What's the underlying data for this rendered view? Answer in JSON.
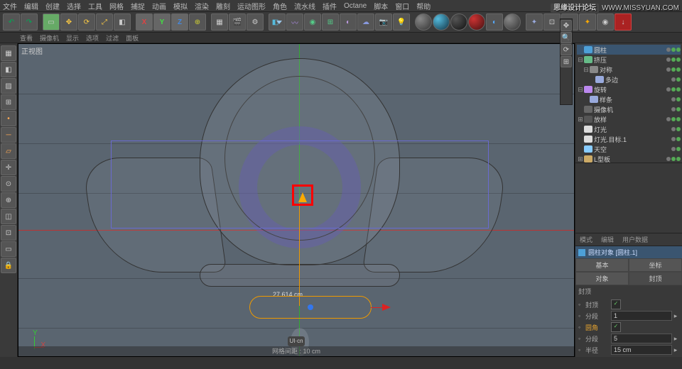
{
  "menu": {
    "file": "文件",
    "edit": "编辑",
    "create": "创建",
    "select": "选择",
    "tools": "工具",
    "mesh": "网格",
    "capture": "捕捉",
    "animate": "动画",
    "simulate": "模拟",
    "render": "渲染",
    "sculpt": "雕刻",
    "motiongfx": "运动图形",
    "character": "角色",
    "pipeline": "流水线",
    "plugins": "插件",
    "octane": "Octane",
    "script": "脚本",
    "window": "窗口",
    "help": "帮助"
  },
  "subbar": {
    "view": "查看",
    "camera": "摄像机",
    "display": "显示",
    "options": "选项",
    "filter": "过滤",
    "panel": "面板"
  },
  "viewport": {
    "title": "正视图",
    "dim": "27.614 cm",
    "gridinfo": "网格间距 : 10 cm",
    "logo": "UI·cn"
  },
  "watermark": {
    "label": "思缘设计论坛",
    "url": "WWW.MISSYUAN.COM"
  },
  "hier": {
    "items": [
      {
        "icon": "ico-cyl",
        "label": "圆柱",
        "exp": ""
      },
      {
        "icon": "ico-ext",
        "label": "挤压",
        "exp": "⊟"
      },
      {
        "icon": "ico-sym",
        "label": "对称",
        "exp": "⊟"
      },
      {
        "icon": "ico-spl",
        "label": "多边",
        "exp": ""
      },
      {
        "icon": "ico-lathe",
        "label": "旋转",
        "exp": "⊟"
      },
      {
        "icon": "ico-spl",
        "label": "样条",
        "exp": ""
      },
      {
        "icon": "ico-cam",
        "label": "摄像机",
        "exp": ""
      },
      {
        "icon": "ico-null",
        "label": "放样",
        "exp": "⊞"
      },
      {
        "icon": "ico-lt",
        "label": "灯光",
        "exp": ""
      },
      {
        "icon": "ico-lt",
        "label": "灯光.目标.1",
        "exp": ""
      },
      {
        "icon": "ico-sky",
        "label": "天空",
        "exp": ""
      },
      {
        "icon": "ico-flr",
        "label": "L型板",
        "exp": "⊞"
      }
    ]
  },
  "attr": {
    "tab_mode": "模式",
    "tab_edit": "编辑",
    "tab_user": "用户数据",
    "title": "圆柱对象 [圆柱.1]",
    "tab_basic": "基本",
    "tab_coord": "坐标",
    "tab_obj": "对象",
    "tab_caps": "封顶",
    "section": "封顶",
    "cap_label": "封顶",
    "cap_check": "✓",
    "seg1_label": "分段",
    "seg1_val": "1",
    "fillet_label": "圆角",
    "fillet_check": "✓",
    "seg2_label": "分段",
    "seg2_val": "5",
    "radius_label": "半径",
    "radius_val": "15 cm"
  }
}
